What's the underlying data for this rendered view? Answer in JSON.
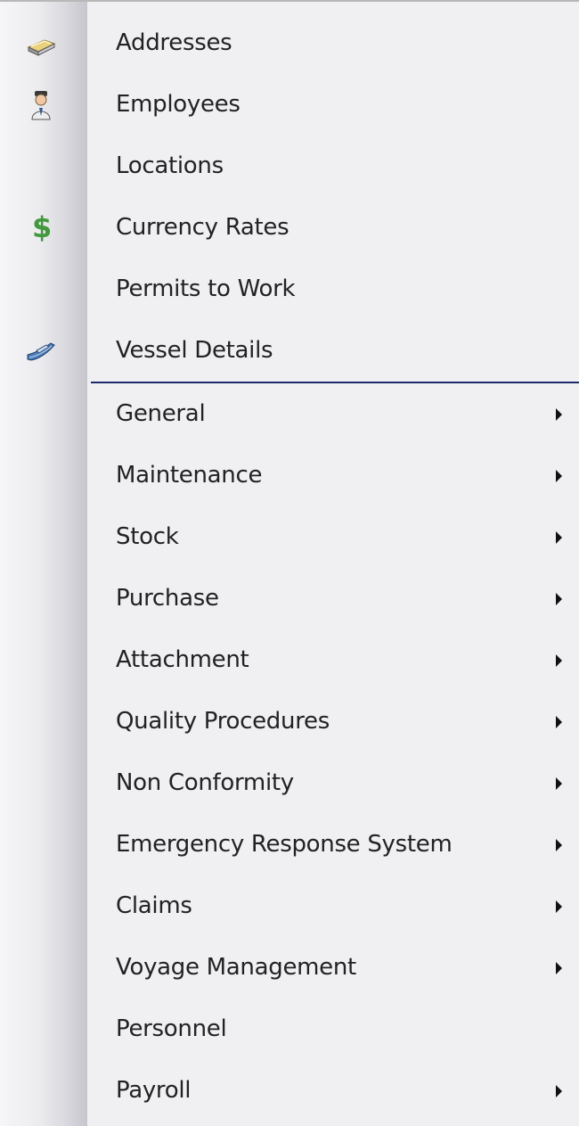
{
  "menu": {
    "top_items": [
      {
        "label": "Addresses",
        "icon": "address-book-icon"
      },
      {
        "label": "Employees",
        "icon": "employee-icon"
      },
      {
        "label": "Locations",
        "icon": ""
      },
      {
        "label": "Currency Rates",
        "icon": "dollar-icon",
        "icon_glyph": "$"
      },
      {
        "label": "Permits to Work",
        "icon": ""
      },
      {
        "label": "Vessel Details",
        "icon": "vessel-icon"
      }
    ],
    "submenus": [
      {
        "label": "General",
        "has_submenu": true
      },
      {
        "label": "Maintenance",
        "has_submenu": true
      },
      {
        "label": "Stock",
        "has_submenu": true
      },
      {
        "label": "Purchase",
        "has_submenu": true
      },
      {
        "label": "Attachment",
        "has_submenu": true
      },
      {
        "label": "Quality Procedures",
        "has_submenu": true
      },
      {
        "label": "Non Conformity",
        "has_submenu": true
      },
      {
        "label": "Emergency Response System",
        "has_submenu": true
      },
      {
        "label": "Claims",
        "has_submenu": true
      },
      {
        "label": "Voyage Management",
        "has_submenu": true
      },
      {
        "label": "Personnel",
        "has_submenu": false
      },
      {
        "label": "Payroll",
        "has_submenu": true
      }
    ]
  },
  "colors": {
    "menu_background": "#f0eff2",
    "separator": "#1c2a6b",
    "text": "#222222",
    "dollar_icon": "#3f9a3a"
  }
}
